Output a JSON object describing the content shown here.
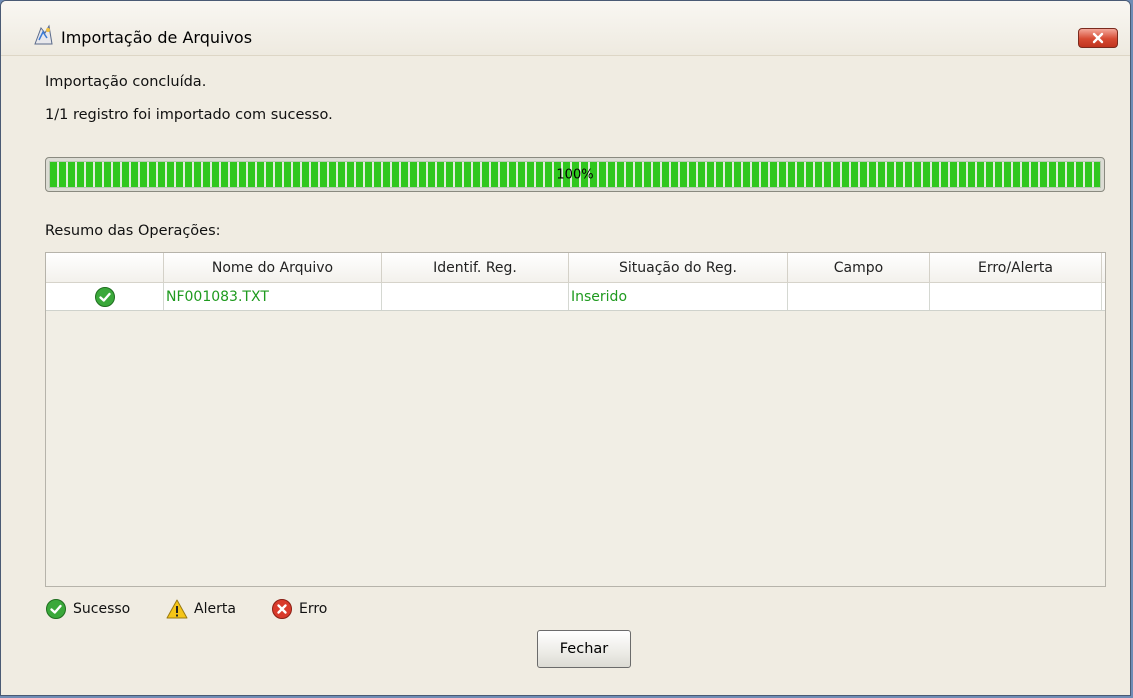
{
  "window": {
    "title": "Importação de Arquivos",
    "app_icon": "import-files-icon",
    "close_icon": "close-icon"
  },
  "messages": {
    "status": "Importação concluída.",
    "summary": "1/1 registro foi importado com sucesso."
  },
  "progress": {
    "value": 100,
    "label": "100%"
  },
  "operations": {
    "label": "Resumo das Operações:",
    "columns": [
      "",
      "Nome do Arquivo",
      "Identif. Reg.",
      "Situação do Reg.",
      "Campo",
      "Erro/Alerta"
    ],
    "rows": [
      {
        "status_icon": "success-icon",
        "file_name": "NF001083.TXT",
        "record_id": "",
        "record_status": "Inserido",
        "field": "",
        "error_alert": ""
      }
    ]
  },
  "legend": {
    "success": "Sucesso",
    "alert": "Alerta",
    "error": "Erro"
  },
  "buttons": {
    "close": "Fechar"
  },
  "colors": {
    "success_text": "#1e9a1e",
    "progress_green": "#2fc71e",
    "close_red": "#d64a32"
  }
}
